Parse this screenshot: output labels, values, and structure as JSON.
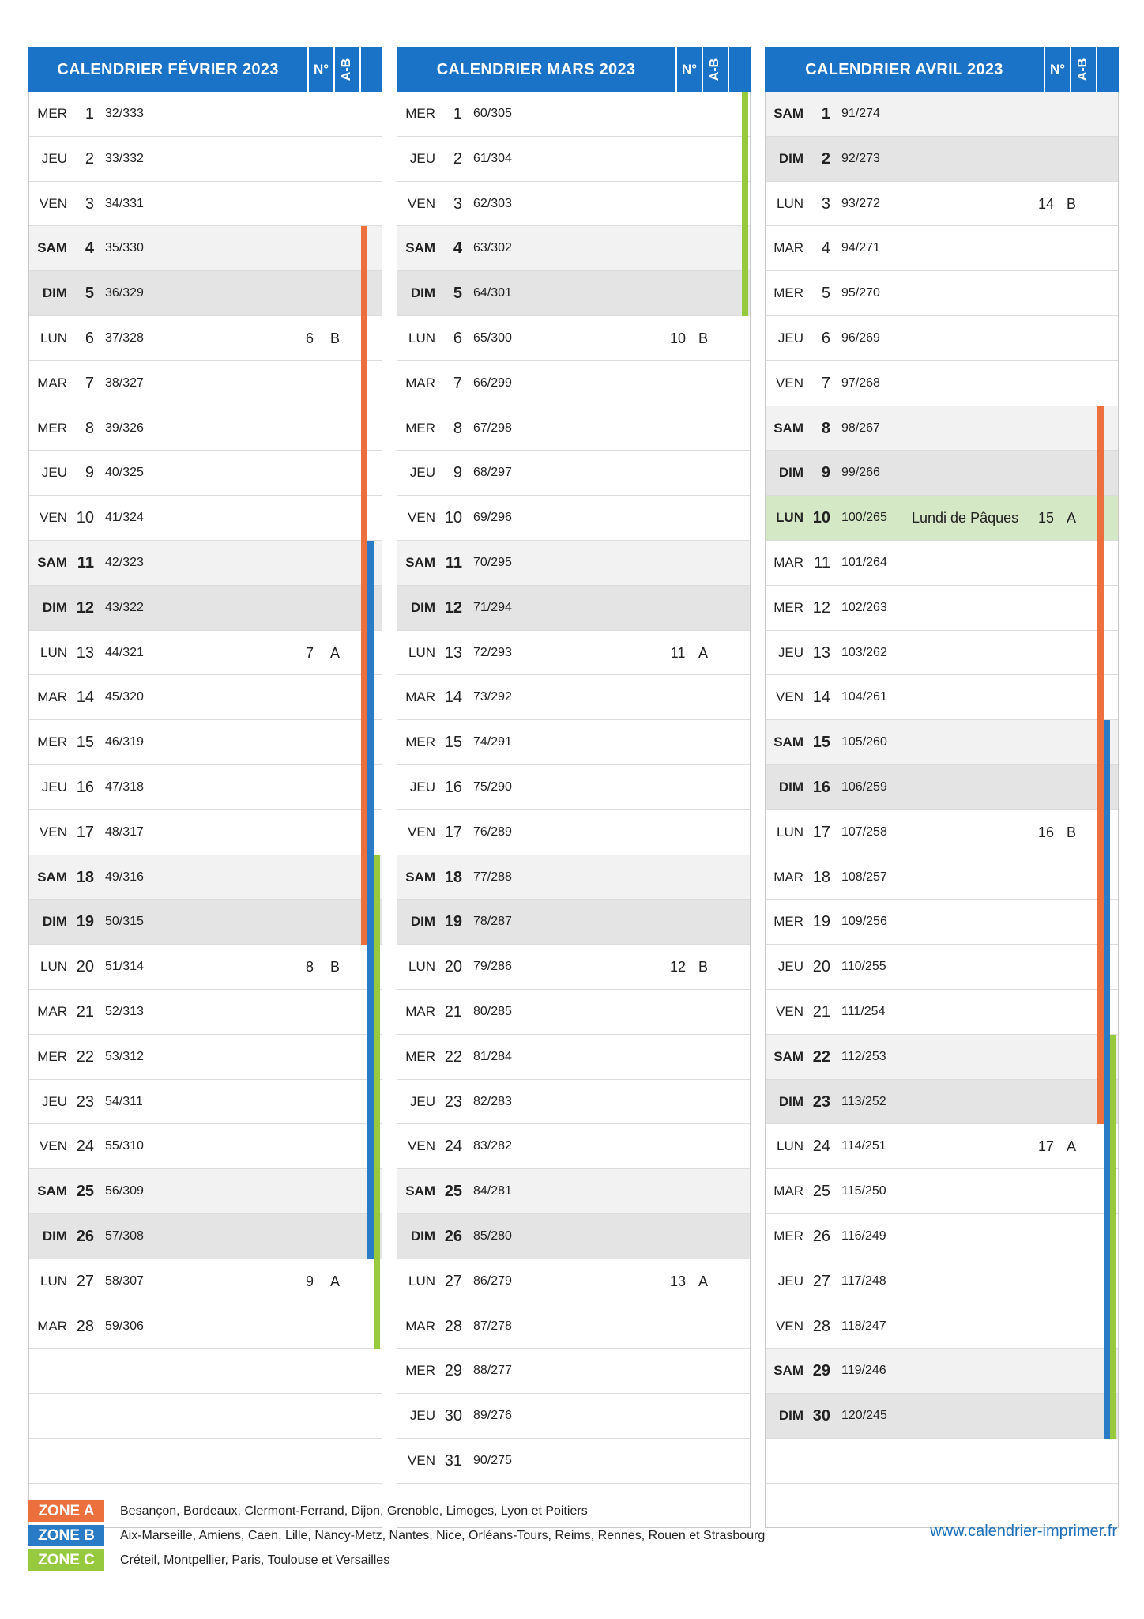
{
  "headers": {
    "number_label": "N°",
    "ab_label": "A-B"
  },
  "colors": {
    "header_blue": "#1a73c7",
    "zone_a": "#ec6f3e",
    "zone_b": "#2a7bc6",
    "zone_c": "#96c93d",
    "holiday_bg": "#d4e8c5",
    "sat_bg": "#f2f2f2",
    "sun_bg": "#e4e4e4"
  },
  "months": [
    {
      "title": "CALENDRIER FÉVRIER 2023",
      "total_rows": 31,
      "days": [
        {
          "d": "MER",
          "n": "1",
          "y": "32/333"
        },
        {
          "d": "JEU",
          "n": "2",
          "y": "33/332"
        },
        {
          "d": "VEN",
          "n": "3",
          "y": "34/331"
        },
        {
          "d": "SAM",
          "n": "4",
          "y": "35/330"
        },
        {
          "d": "DIM",
          "n": "5",
          "y": "36/329"
        },
        {
          "d": "LUN",
          "n": "6",
          "y": "37/328",
          "w": "6",
          "ab": "B"
        },
        {
          "d": "MAR",
          "n": "7",
          "y": "38/327"
        },
        {
          "d": "MER",
          "n": "8",
          "y": "39/326"
        },
        {
          "d": "JEU",
          "n": "9",
          "y": "40/325"
        },
        {
          "d": "VEN",
          "n": "10",
          "y": "41/324"
        },
        {
          "d": "SAM",
          "n": "11",
          "y": "42/323"
        },
        {
          "d": "DIM",
          "n": "12",
          "y": "43/322"
        },
        {
          "d": "LUN",
          "n": "13",
          "y": "44/321",
          "w": "7",
          "ab": "A"
        },
        {
          "d": "MAR",
          "n": "14",
          "y": "45/320"
        },
        {
          "d": "MER",
          "n": "15",
          "y": "46/319"
        },
        {
          "d": "JEU",
          "n": "16",
          "y": "47/318"
        },
        {
          "d": "VEN",
          "n": "17",
          "y": "48/317"
        },
        {
          "d": "SAM",
          "n": "18",
          "y": "49/316"
        },
        {
          "d": "DIM",
          "n": "19",
          "y": "50/315"
        },
        {
          "d": "LUN",
          "n": "20",
          "y": "51/314",
          "w": "8",
          "ab": "B"
        },
        {
          "d": "MAR",
          "n": "21",
          "y": "52/313"
        },
        {
          "d": "MER",
          "n": "22",
          "y": "53/312"
        },
        {
          "d": "JEU",
          "n": "23",
          "y": "54/311"
        },
        {
          "d": "VEN",
          "n": "24",
          "y": "55/310"
        },
        {
          "d": "SAM",
          "n": "25",
          "y": "56/309"
        },
        {
          "d": "DIM",
          "n": "26",
          "y": "57/308"
        },
        {
          "d": "LUN",
          "n": "27",
          "y": "58/307",
          "w": "9",
          "ab": "A"
        },
        {
          "d": "MAR",
          "n": "28",
          "y": "59/306"
        }
      ],
      "bars": [
        {
          "zone": "a",
          "from": 4,
          "to": 19
        },
        {
          "zone": "b",
          "from": 11,
          "to": 26
        },
        {
          "zone": "c",
          "from": 18,
          "to": 28
        }
      ]
    },
    {
      "title": "CALENDRIER MARS 2023",
      "total_rows": 31,
      "days": [
        {
          "d": "MER",
          "n": "1",
          "y": "60/305"
        },
        {
          "d": "JEU",
          "n": "2",
          "y": "61/304"
        },
        {
          "d": "VEN",
          "n": "3",
          "y": "62/303"
        },
        {
          "d": "SAM",
          "n": "4",
          "y": "63/302"
        },
        {
          "d": "DIM",
          "n": "5",
          "y": "64/301"
        },
        {
          "d": "LUN",
          "n": "6",
          "y": "65/300",
          "w": "10",
          "ab": "B"
        },
        {
          "d": "MAR",
          "n": "7",
          "y": "66/299"
        },
        {
          "d": "MER",
          "n": "8",
          "y": "67/298"
        },
        {
          "d": "JEU",
          "n": "9",
          "y": "68/297"
        },
        {
          "d": "VEN",
          "n": "10",
          "y": "69/296"
        },
        {
          "d": "SAM",
          "n": "11",
          "y": "70/295"
        },
        {
          "d": "DIM",
          "n": "12",
          "y": "71/294"
        },
        {
          "d": "LUN",
          "n": "13",
          "y": "72/293",
          "w": "11",
          "ab": "A"
        },
        {
          "d": "MAR",
          "n": "14",
          "y": "73/292"
        },
        {
          "d": "MER",
          "n": "15",
          "y": "74/291"
        },
        {
          "d": "JEU",
          "n": "16",
          "y": "75/290"
        },
        {
          "d": "VEN",
          "n": "17",
          "y": "76/289"
        },
        {
          "d": "SAM",
          "n": "18",
          "y": "77/288"
        },
        {
          "d": "DIM",
          "n": "19",
          "y": "78/287"
        },
        {
          "d": "LUN",
          "n": "20",
          "y": "79/286",
          "w": "12",
          "ab": "B"
        },
        {
          "d": "MAR",
          "n": "21",
          "y": "80/285"
        },
        {
          "d": "MER",
          "n": "22",
          "y": "81/284"
        },
        {
          "d": "JEU",
          "n": "23",
          "y": "82/283"
        },
        {
          "d": "VEN",
          "n": "24",
          "y": "83/282"
        },
        {
          "d": "SAM",
          "n": "25",
          "y": "84/281"
        },
        {
          "d": "DIM",
          "n": "26",
          "y": "85/280"
        },
        {
          "d": "LUN",
          "n": "27",
          "y": "86/279",
          "w": "13",
          "ab": "A"
        },
        {
          "d": "MAR",
          "n": "28",
          "y": "87/278"
        },
        {
          "d": "MER",
          "n": "29",
          "y": "88/277"
        },
        {
          "d": "JEU",
          "n": "30",
          "y": "89/276"
        },
        {
          "d": "VEN",
          "n": "31",
          "y": "90/275"
        }
      ],
      "bars": [
        {
          "zone": "c",
          "from": 1,
          "to": 5
        }
      ]
    },
    {
      "title": "CALENDRIER AVRIL 2023",
      "total_rows": 31,
      "days": [
        {
          "d": "SAM",
          "n": "1",
          "y": "91/274"
        },
        {
          "d": "DIM",
          "n": "2",
          "y": "92/273"
        },
        {
          "d": "LUN",
          "n": "3",
          "y": "93/272",
          "w": "14",
          "ab": "B"
        },
        {
          "d": "MAR",
          "n": "4",
          "y": "94/271"
        },
        {
          "d": "MER",
          "n": "5",
          "y": "95/270"
        },
        {
          "d": "JEU",
          "n": "6",
          "y": "96/269"
        },
        {
          "d": "VEN",
          "n": "7",
          "y": "97/268"
        },
        {
          "d": "SAM",
          "n": "8",
          "y": "98/267"
        },
        {
          "d": "DIM",
          "n": "9",
          "y": "99/266"
        },
        {
          "d": "LUN",
          "n": "10",
          "y": "100/265",
          "w": "15",
          "ab": "A",
          "h": "Lundi de Pâques"
        },
        {
          "d": "MAR",
          "n": "11",
          "y": "101/264"
        },
        {
          "d": "MER",
          "n": "12",
          "y": "102/263"
        },
        {
          "d": "JEU",
          "n": "13",
          "y": "103/262"
        },
        {
          "d": "VEN",
          "n": "14",
          "y": "104/261"
        },
        {
          "d": "SAM",
          "n": "15",
          "y": "105/260"
        },
        {
          "d": "DIM",
          "n": "16",
          "y": "106/259"
        },
        {
          "d": "LUN",
          "n": "17",
          "y": "107/258",
          "w": "16",
          "ab": "B"
        },
        {
          "d": "MAR",
          "n": "18",
          "y": "108/257"
        },
        {
          "d": "MER",
          "n": "19",
          "y": "109/256"
        },
        {
          "d": "JEU",
          "n": "20",
          "y": "110/255"
        },
        {
          "d": "VEN",
          "n": "21",
          "y": "111/254"
        },
        {
          "d": "SAM",
          "n": "22",
          "y": "112/253"
        },
        {
          "d": "DIM",
          "n": "23",
          "y": "113/252"
        },
        {
          "d": "LUN",
          "n": "24",
          "y": "114/251",
          "w": "17",
          "ab": "A"
        },
        {
          "d": "MAR",
          "n": "25",
          "y": "115/250"
        },
        {
          "d": "MER",
          "n": "26",
          "y": "116/249"
        },
        {
          "d": "JEU",
          "n": "27",
          "y": "117/248"
        },
        {
          "d": "VEN",
          "n": "28",
          "y": "118/247"
        },
        {
          "d": "SAM",
          "n": "29",
          "y": "119/246"
        },
        {
          "d": "DIM",
          "n": "30",
          "y": "120/245"
        }
      ],
      "bars": [
        {
          "zone": "a",
          "from": 8,
          "to": 23
        },
        {
          "zone": "b",
          "from": 15,
          "to": 30
        },
        {
          "zone": "c",
          "from": 22,
          "to": 30
        }
      ]
    }
  ],
  "legend": [
    {
      "zone": "a",
      "label": "ZONE A",
      "text": "Besançon, Bordeaux, Clermont-Ferrand, Dijon, Grenoble, Limoges, Lyon et Poitiers"
    },
    {
      "zone": "b",
      "label": "ZONE B",
      "text": "Aix-Marseille, Amiens, Caen, Lille, Nancy-Metz, Nantes, Nice, Orléans-Tours, Reims, Rennes, Rouen et Strasbourg"
    },
    {
      "zone": "c",
      "label": "ZONE C",
      "text": "Créteil, Montpellier, Paris, Toulouse et Versailles"
    }
  ],
  "website": "www.calendrier-imprimer.fr"
}
